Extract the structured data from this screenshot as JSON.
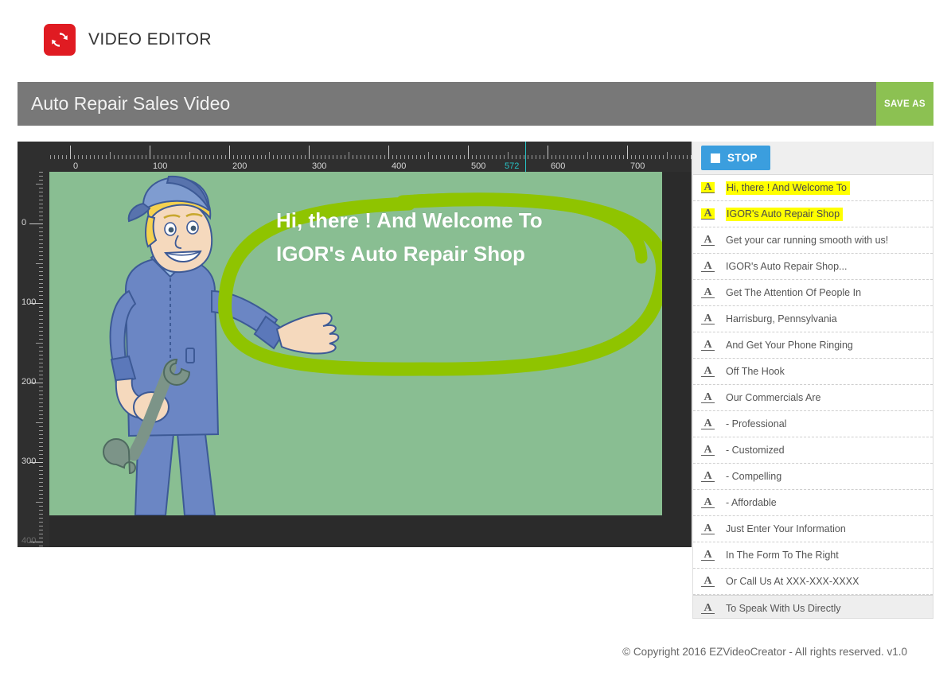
{
  "brand": {
    "logo_icon": "sync-refresh-icon",
    "logo_color": "#e01b22",
    "title": "VIDEO EDITOR"
  },
  "titlebar": {
    "project_name": "Auto Repair Sales Video",
    "save_label": "SAVE AS",
    "bar_color": "#787878",
    "save_color": "#8cc152"
  },
  "editor": {
    "ruler_h": {
      "labels": [
        "0",
        "100",
        "200",
        "300",
        "400",
        "500",
        "600",
        "700"
      ],
      "values": [
        0,
        100,
        200,
        300,
        400,
        500,
        600,
        700
      ]
    },
    "ruler_v": {
      "labels": [
        "0",
        "100",
        "200",
        "300",
        "400"
      ],
      "values": [
        0,
        100,
        200,
        300,
        400
      ]
    },
    "playhead": {
      "position_label": "572",
      "position_value": 572,
      "color": "#27c3c6"
    },
    "canvas": {
      "background_color": "#89be92",
      "scene_icon": "mechanic-character",
      "overlay_line1": "Hi, there ! And Welcome To",
      "overlay_line2": "IGOR's Auto Repair Shop",
      "annotation_icon": "hand-drawn-ellipse",
      "annotation_color": "#8fc400"
    }
  },
  "panel": {
    "playback": {
      "stop_label": "STOP",
      "stop_icon": "stop-square-icon",
      "stop_color": "#3b9ede"
    },
    "clips": [
      {
        "icon": "text-a-icon",
        "label": "Hi, there ! And Welcome To",
        "highlighted": true,
        "selected": false
      },
      {
        "icon": "text-a-icon",
        "label": "IGOR's Auto Repair Shop",
        "highlighted": true,
        "selected": false
      },
      {
        "icon": "text-a-icon",
        "label": "Get your car running smooth with us!",
        "highlighted": false,
        "selected": false
      },
      {
        "icon": "text-a-icon",
        "label": "IGOR's Auto Repair Shop...",
        "highlighted": false,
        "selected": false
      },
      {
        "icon": "text-a-icon",
        "label": "Get The Attention Of People In",
        "highlighted": false,
        "selected": false
      },
      {
        "icon": "text-a-icon",
        "label": "Harrisburg, Pennsylvania",
        "highlighted": false,
        "selected": false
      },
      {
        "icon": "text-a-icon",
        "label": "And Get Your Phone Ringing",
        "highlighted": false,
        "selected": false
      },
      {
        "icon": "text-a-icon",
        "label": "Off The Hook",
        "highlighted": false,
        "selected": false
      },
      {
        "icon": "text-a-icon",
        "label": "Our Commercials Are",
        "highlighted": false,
        "selected": false
      },
      {
        "icon": "text-a-icon",
        "label": "- Professional",
        "highlighted": false,
        "selected": false
      },
      {
        "icon": "text-a-icon",
        "label": "- Customized",
        "highlighted": false,
        "selected": false
      },
      {
        "icon": "text-a-icon",
        "label": "- Compelling",
        "highlighted": false,
        "selected": false
      },
      {
        "icon": "text-a-icon",
        "label": "- Affordable",
        "highlighted": false,
        "selected": false
      },
      {
        "icon": "text-a-icon",
        "label": "Just Enter Your Information",
        "highlighted": false,
        "selected": false
      },
      {
        "icon": "text-a-icon",
        "label": "In The Form To The Right",
        "highlighted": false,
        "selected": false
      },
      {
        "icon": "text-a-icon",
        "label": "Or Call Us At XXX-XXX-XXXX",
        "highlighted": false,
        "selected": false
      },
      {
        "icon": "text-a-icon",
        "label": "To Speak With Us Directly",
        "highlighted": false,
        "selected": true
      }
    ]
  },
  "footer": {
    "copyright": "© Copyright 2016 EZVideoCreator - All rights reserved. v1.0"
  }
}
